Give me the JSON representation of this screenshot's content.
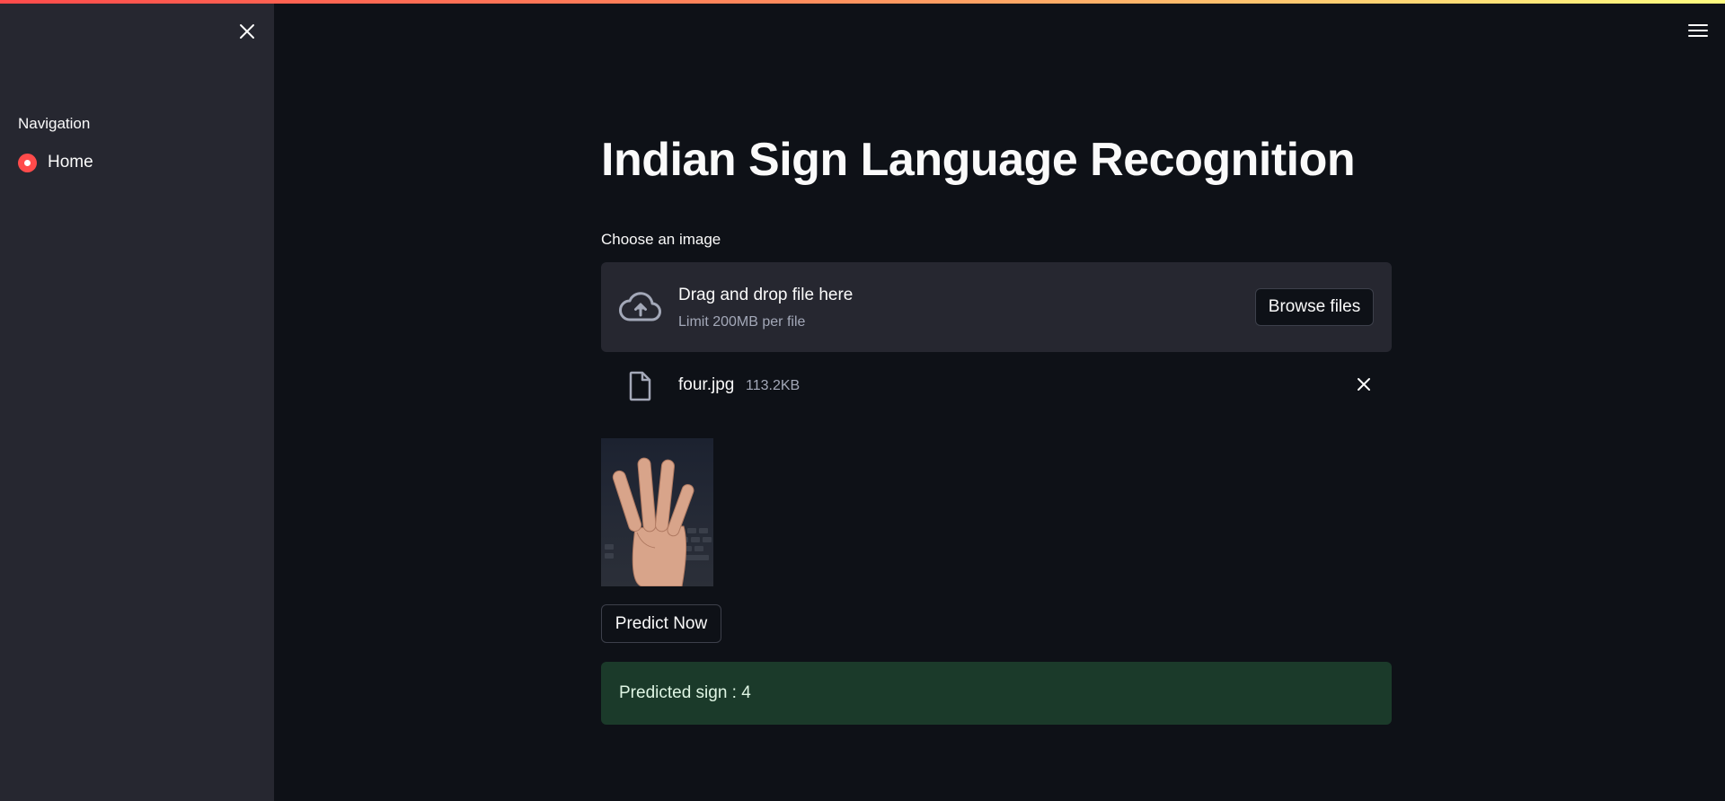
{
  "sidebar": {
    "navigation_heading": "Navigation",
    "items": [
      {
        "label": "Home",
        "selected": true
      }
    ]
  },
  "main": {
    "title": "Indian Sign Language Recognition",
    "uploader": {
      "label": "Choose an image",
      "dropzone_title": "Drag and drop file here",
      "dropzone_limit": "Limit 200MB per file",
      "browse_label": "Browse files",
      "file": {
        "name": "four.jpg",
        "size": "113.2KB"
      }
    },
    "predict_label": "Predict Now",
    "result": "Predicted sign : 4"
  },
  "colors": {
    "accent": "#ff4b4b",
    "background": "#0e1117",
    "sidebar": "#262730",
    "success_bg": "#1b3a2a"
  },
  "icons": [
    "close-icon",
    "hamburger-menu-icon",
    "cloud-upload-icon",
    "file-icon",
    "remove-file-icon"
  ]
}
